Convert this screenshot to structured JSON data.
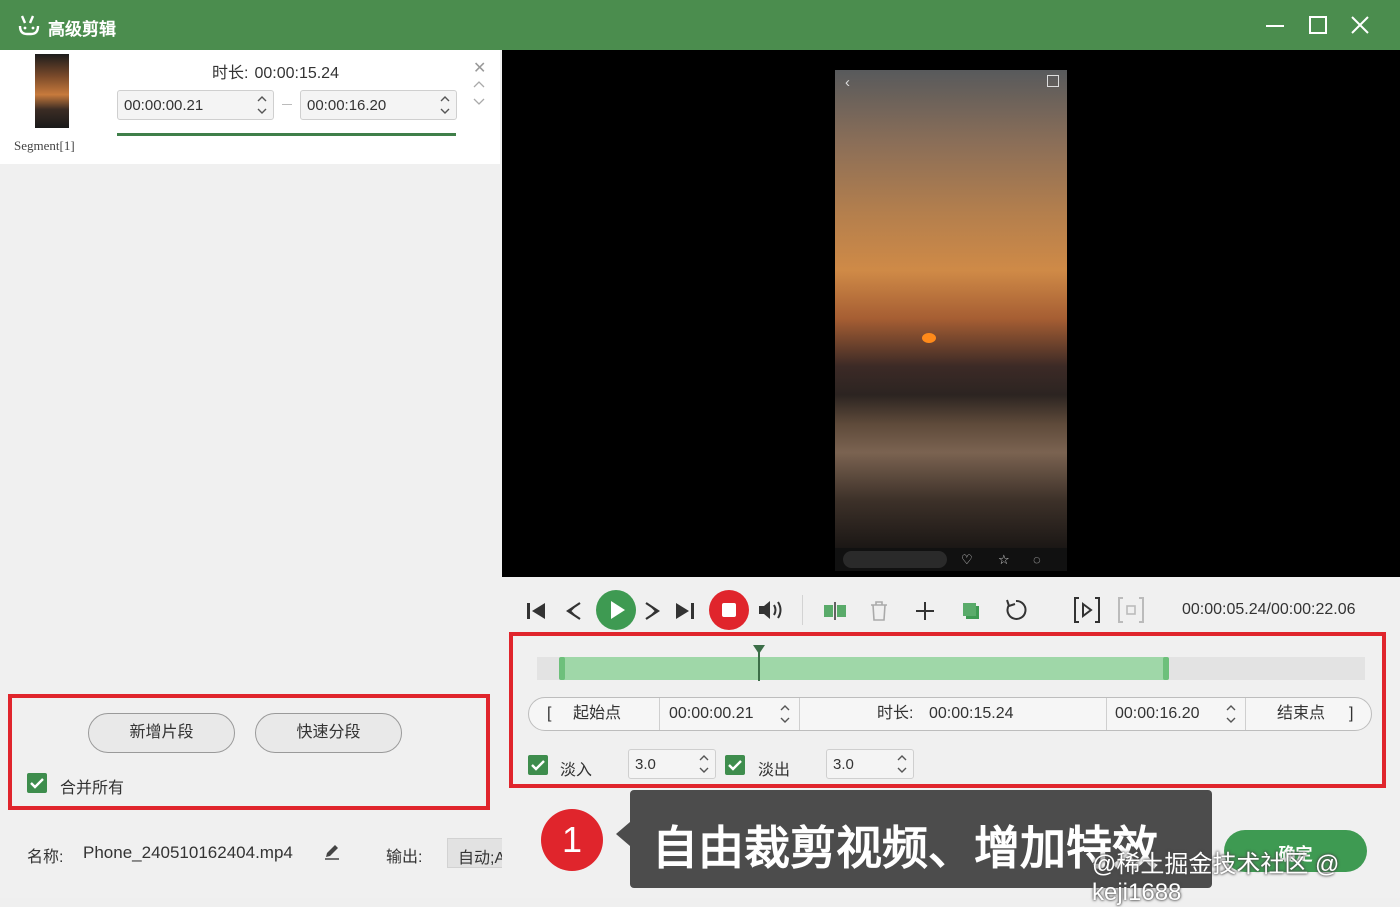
{
  "app": {
    "title": "高级剪辑"
  },
  "segment": {
    "label": "Segment[1]",
    "duration_label": "时长:",
    "duration_value": "00:00:15.24",
    "start": "00:00:00.21",
    "end": "00:00:16.20"
  },
  "left_panel": {
    "add_segment": "新增片段",
    "quick_split": "快速分段",
    "merge_all": "合并所有"
  },
  "bottom": {
    "name_label": "名称:",
    "file_name": "Phone_240510162404.mp4",
    "output_label": "输出:",
    "output_value": "自动;Auto"
  },
  "player": {
    "time": "00:00:05.24/00:00:22.06",
    "progress": 0.24
  },
  "trim": {
    "start_label": "起始点",
    "start_value": "00:00:00.21",
    "duration_label": "时长:",
    "duration_value": "00:00:15.24",
    "end_value": "00:00:16.20",
    "end_label": "结束点"
  },
  "fade": {
    "in_label": "淡入",
    "in_value": "3.0",
    "out_label": "淡出",
    "out_value": "3.0"
  },
  "callout": {
    "number": "1",
    "text": "自由裁剪视频、增加特效"
  },
  "action_button": "确定",
  "watermark": "@稀土掘金技术社区 @ keji1688",
  "colors": {
    "accent": "#4b8d4e",
    "highlight": "#e0252c",
    "timeline_selection": "#9fd7a8"
  }
}
